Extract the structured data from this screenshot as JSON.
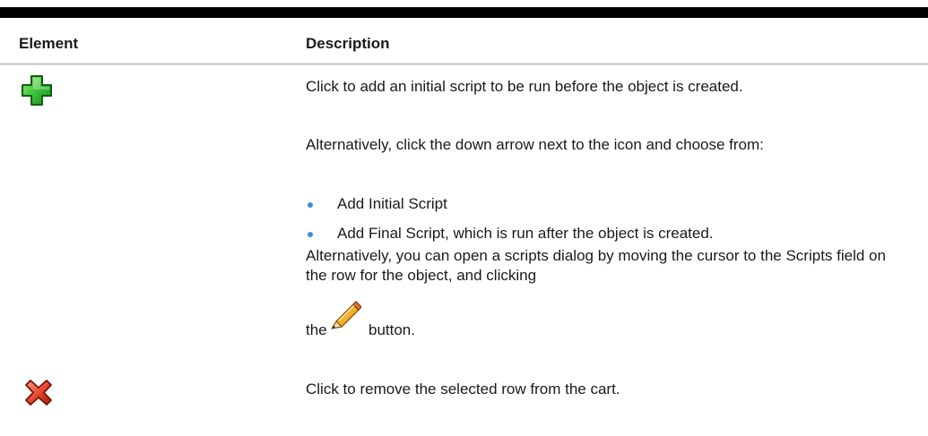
{
  "table": {
    "headers": {
      "element": "Element",
      "description": "Description"
    },
    "rows": [
      {
        "icon": "add-plus-icon",
        "paragraphs": [
          "Click to add an initial script to be run before the object is created.",
          "Alternatively, click the down arrow next to the icon and choose from:"
        ],
        "bullets": [
          "Add Initial Script",
          "Add Final Script, which is run after the object is created."
        ],
        "closing": {
          "text": "Alternatively, you can open a scripts dialog by moving the cursor to the Scripts field on the row for the object, and clicking",
          "before_icon": "the",
          "icon": "pencil-icon",
          "after_icon": "button."
        }
      },
      {
        "icon": "remove-x-icon",
        "paragraphs": [
          "Click to remove the selected row from the cart."
        ]
      }
    ]
  },
  "colors": {
    "rule": "#000000",
    "bullet": "#3b8ed4",
    "add_icon": "#2fb12f",
    "remove_icon": "#d83a2a"
  }
}
